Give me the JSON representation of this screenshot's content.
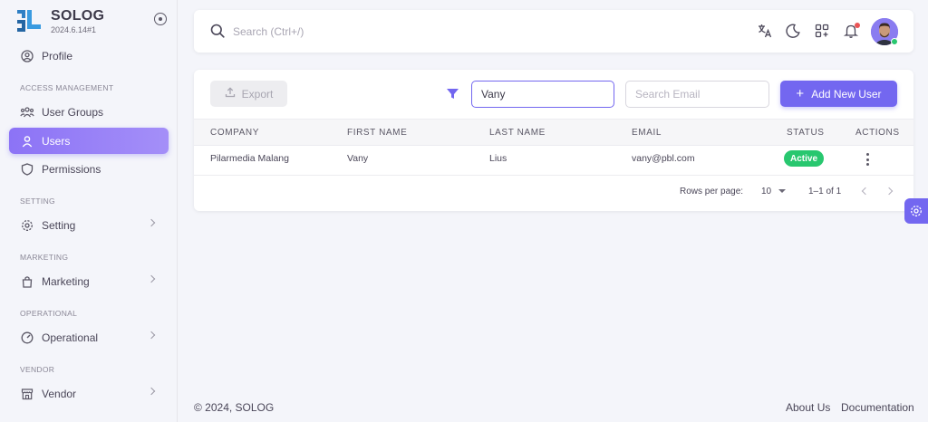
{
  "brand": {
    "name": "SOLOG",
    "version": "2024.6.14#1"
  },
  "sidebar": {
    "profile": "Profile",
    "sections": {
      "access": "ACCESS MANAGEMENT",
      "setting": "SETTING",
      "marketing": "MARKETING",
      "operational": "OPERATIONAL",
      "vendor": "VENDOR"
    },
    "items": {
      "user_groups": "User Groups",
      "users": "Users",
      "permissions": "Permissions",
      "setting": "Setting",
      "marketing": "Marketing",
      "operational": "Operational",
      "vendor": "Vendor"
    }
  },
  "topbar": {
    "search_placeholder": "Search (Ctrl+/)"
  },
  "toolbar": {
    "export_label": "Export",
    "name_filter_value": "Vany",
    "email_placeholder": "Search Email",
    "add_label": "Add New User"
  },
  "table": {
    "headers": {
      "company": "COMPANY",
      "first_name": "FIRST NAME",
      "last_name": "LAST NAME",
      "email": "EMAIL",
      "status": "STATUS",
      "actions": "ACTIONS"
    },
    "rows": [
      {
        "company": "Pilarmedia Malang",
        "first_name": "Vany",
        "last_name": "Lius",
        "email": "vany@pbl.com",
        "status": "Active"
      }
    ]
  },
  "pagination": {
    "rows_per_page_label": "Rows per page:",
    "rows_per_page": "10",
    "range": "1–1 of 1"
  },
  "footer": {
    "copyright": "© 2024, SOLOG",
    "about": "About Us",
    "docs": "Documentation"
  },
  "colors": {
    "primary": "#7367f0",
    "success": "#28c76f",
    "danger": "#ea5455"
  }
}
